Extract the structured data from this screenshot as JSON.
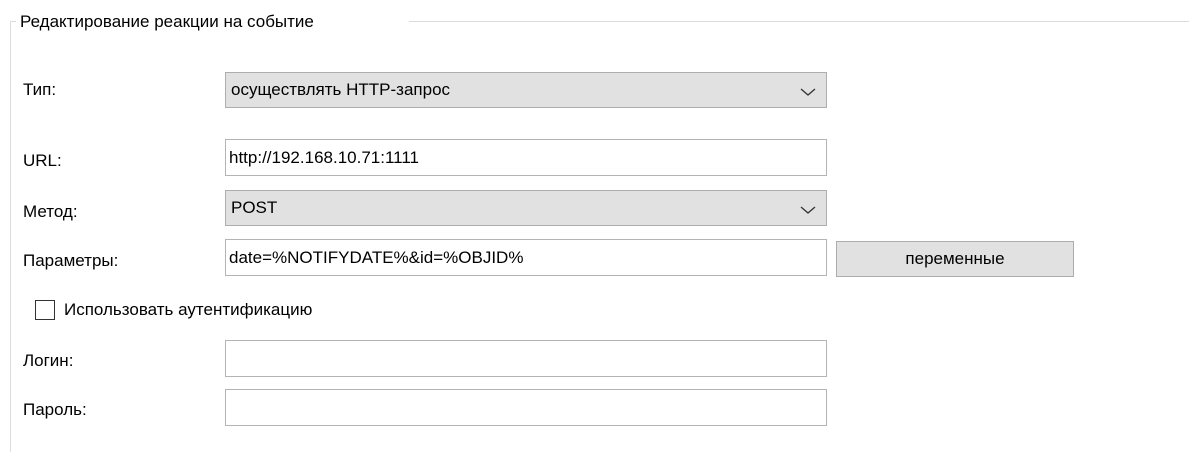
{
  "group": {
    "title": "Редактирование реакции на событие"
  },
  "type": {
    "label": "Тип:",
    "value": "осуществлять HTTP-запрос",
    "arrow_icon": "chevron-down-icon"
  },
  "url": {
    "label": "URL:",
    "value": "http://192.168.10.71:1111"
  },
  "method": {
    "label": "Метод:",
    "value": "POST",
    "arrow_icon": "chevron-down-icon"
  },
  "params": {
    "label": "Параметры:",
    "value": "date=%NOTIFYDATE%&id=%OBJID%",
    "variables_button": "переменные"
  },
  "auth": {
    "checkbox_label": "Использовать аутентификацию",
    "checked": false
  },
  "login": {
    "label": "Логин:",
    "value": ""
  },
  "password": {
    "label": "Пароль:",
    "value": ""
  },
  "colors": {
    "combo_bg": "#e1e1e1",
    "border": "#adadad",
    "group_border": "#dcdcdc"
  }
}
